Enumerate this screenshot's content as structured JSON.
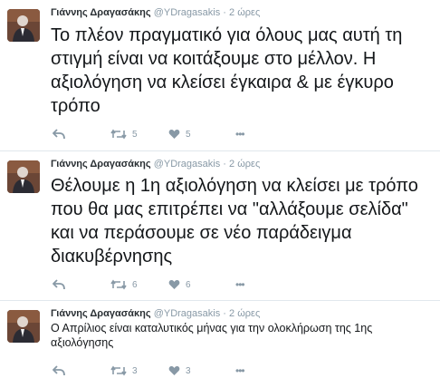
{
  "tweets": [
    {
      "author": "Γιάννης Δραγασάκης",
      "handle": "@YDragasakis",
      "separator": "·",
      "time": "2 ώρες",
      "text": "Το πλέον πραγματικό για όλους μας αυτή τη στιγμή είναι να κοιτάξουμε στο μέλλον. Η αξιολόγηση να κλείσει έγκαιρα & με έγκυρο τρόπο",
      "retweets": "5",
      "likes": "5",
      "more": "•••"
    },
    {
      "author": "Γιάννης Δραγασάκης",
      "handle": "@YDragasakis",
      "separator": "·",
      "time": "2 ώρες",
      "text": "Θέλουμε η 1η αξιολόγηση να κλείσει με τρόπο που θα μας επιτρέπει να \"αλλάξουμε σελίδα\" και να περάσουμε σε νέο παράδειγμα διακυβέρνησης",
      "retweets": "6",
      "likes": "6",
      "more": "•••"
    },
    {
      "author": "Γιάννης Δραγασάκης",
      "handle": "@YDragasakis",
      "separator": "·",
      "time": "2 ώρες",
      "text": "Ο Απρίλιος είναι καταλυτικός μήνας για την ολοκλήρωση της 1ης αξιολόγησης",
      "retweets": "3",
      "likes": "3",
      "more": "•••"
    }
  ],
  "icons": {
    "reply": "reply-icon",
    "retweet": "retweet-icon",
    "like": "heart-icon",
    "more": "more-icon"
  },
  "colors": {
    "text": "#14171a",
    "muted": "#8899a6",
    "separator": "#e1e8ed"
  }
}
